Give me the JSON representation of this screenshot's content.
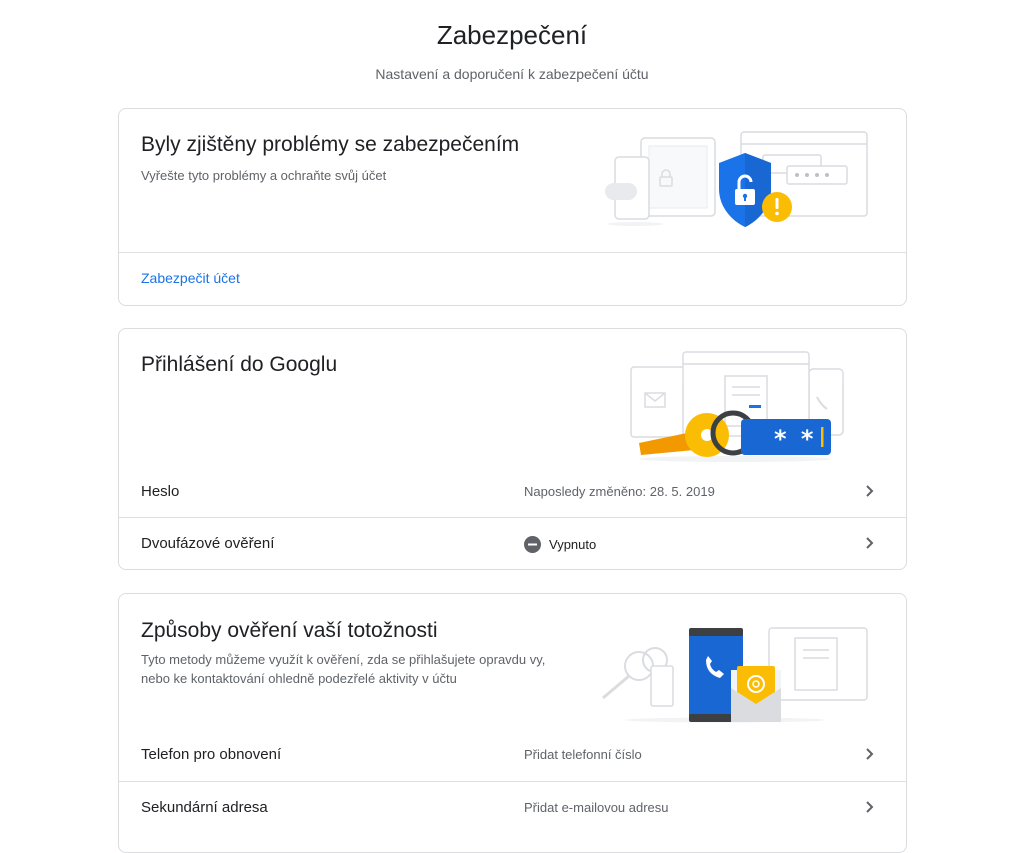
{
  "header": {
    "title": "Zabezpečení",
    "subtitle": "Nastavení a doporučení k zabezpečení účtu"
  },
  "security_issues": {
    "title": "Byly zjištěny problémy se zabezpečením",
    "description": "Vyřešte tyto problémy a ochraňte svůj účet",
    "link_label": "Zabezpečit účet"
  },
  "signin": {
    "title": "Přihlášení do Googlu",
    "password_field": "* *",
    "rows": [
      {
        "label": "Heslo",
        "value": "Naposledy změněno: 28. 5. 2019",
        "icon": "none"
      },
      {
        "label": "Dvoufázové ověření",
        "value": "Vypnuto",
        "icon": "minus-circle-icon"
      }
    ]
  },
  "verify": {
    "title": "Způsoby ověření vaší totožnosti",
    "description_line1": "Tyto metody můžeme využít k ověření, zda se přihlašujete opravdu vy,",
    "description_line2": "nebo ke kontaktování ohledně podezřelé aktivity v účtu",
    "rows": [
      {
        "label": "Telefon pro obnovení",
        "value": "Přidat telefonní číslo"
      },
      {
        "label": "Sekundární adresa",
        "value": "Přidat e-mailovou adresu"
      }
    ]
  },
  "colors": {
    "accent": "#1a73e8",
    "shield": "#1a73e8",
    "warning": "#fbbc04",
    "key": "#f9ab00",
    "status_icon": "#5f6368"
  }
}
